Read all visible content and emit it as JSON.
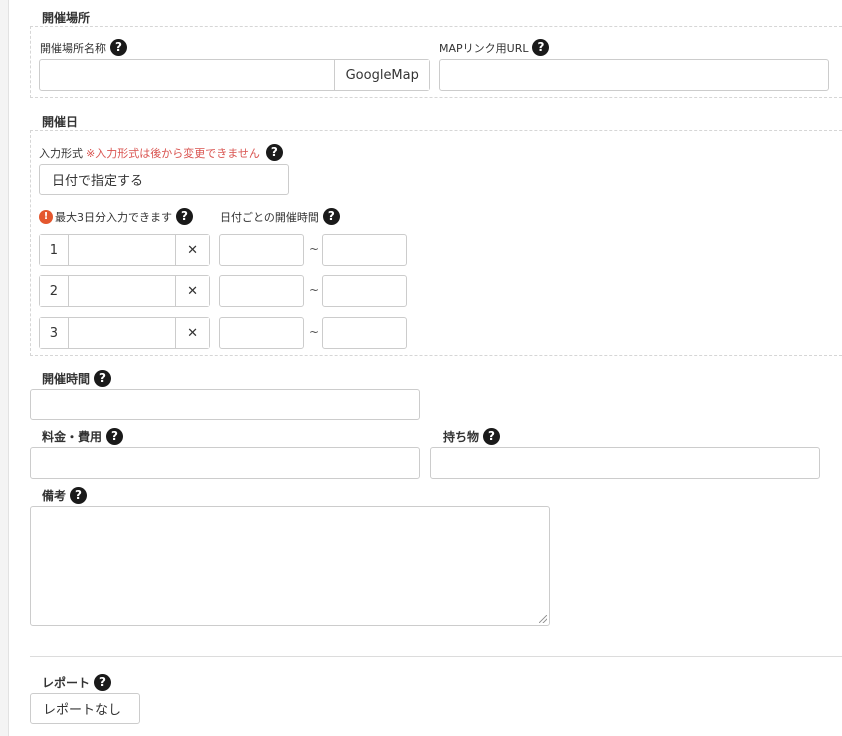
{
  "venue": {
    "section_title": "開催場所",
    "name_label": "開催場所名称",
    "name_value": "",
    "googlemap_button": "GoogleMap",
    "map_url_label": "MAPリンク用URL",
    "map_url_value": ""
  },
  "dates": {
    "section_title": "開催日",
    "input_format_label": "入力形式",
    "input_format_note": "※入力形式は後から変更できません",
    "input_format_selected": "日付で指定する",
    "max_days_warning": "最大3日分入力できます",
    "per_day_time_label": "日付ごとの開催時間",
    "tilde": "~",
    "rows": [
      {
        "index": "1",
        "date": "",
        "start": "",
        "end": ""
      },
      {
        "index": "2",
        "date": "",
        "start": "",
        "end": ""
      },
      {
        "index": "3",
        "date": "",
        "start": "",
        "end": ""
      }
    ]
  },
  "time": {
    "label": "開催時間",
    "value": ""
  },
  "fee": {
    "label": "料金・費用",
    "value": ""
  },
  "belongings": {
    "label": "持ち物",
    "value": ""
  },
  "notes": {
    "label": "備考",
    "value": ""
  },
  "report": {
    "label": "レポート",
    "selected": "レポートなし"
  },
  "icons": {
    "help": "?",
    "warning": "!",
    "clear": "✕"
  }
}
